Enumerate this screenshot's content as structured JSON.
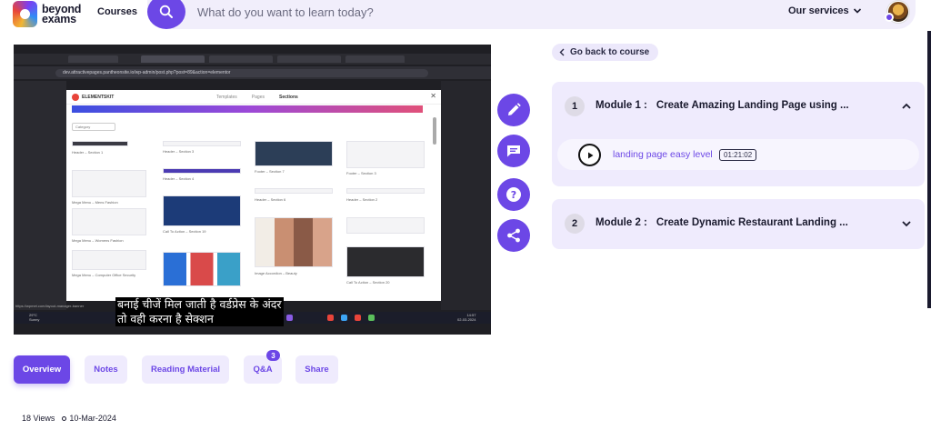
{
  "header": {
    "logo_line1": "beyond",
    "logo_line2": "exams",
    "courses_label": "Courses",
    "search_placeholder": "What do you want to learn today?",
    "services_label": "Our services"
  },
  "video": {
    "url": "dev.attractivepages.pantheonsite.io/wp-admin/post.php?post=89&action=elementor",
    "modal_brand": "ELEMENTSKIT",
    "modal_tabs": [
      "Templates",
      "Pages",
      "Sections"
    ],
    "category_select": "Category",
    "status_link": "https://wpmet.com/layout-manager-banner",
    "temperature": "29°C",
    "weather": "Sunny",
    "time": "14:57",
    "date": "02-03-2024",
    "subtitle_line1": "बनाई चीजें मिल जाती है वर्डप्रेस के अंदर",
    "subtitle_line2": "तो वही करना है सेक्शन",
    "cards": [
      "Header – Section 1",
      "Header – Section 3",
      "Footer – Section 7",
      "Footer – Section 3",
      "Mega Menu – Mens Fashion",
      "Header – Section 4",
      "Header – Section 6",
      "Header – Section 2",
      "Mega Menu – Womens Fashion",
      "Call To Action – Section 19",
      "Image Accordion – Beauty",
      "Call To Action – Section 20",
      "Mega Menu – Computer Office Security"
    ]
  },
  "actions": [
    "edit-icon",
    "chat-icon",
    "help-icon",
    "share-icon"
  ],
  "right_panel": {
    "go_back_label": "Go back to course",
    "modules": [
      {
        "number": "1",
        "label": "Module 1 :",
        "title": "Create Amazing Landing Page using ...",
        "lessons": [
          {
            "title": "landing page easy level",
            "duration": "01:21:02"
          }
        ]
      },
      {
        "number": "2",
        "label": "Module 2 :",
        "title": "Create Dynamic Restaurant Landing ..."
      }
    ]
  },
  "tabs": [
    {
      "label": "Overview",
      "active": true
    },
    {
      "label": "Notes",
      "active": false
    },
    {
      "label": "Reading Material",
      "active": false
    },
    {
      "label": "Q&A",
      "active": false,
      "badge": "3"
    },
    {
      "label": "Share",
      "active": false
    }
  ],
  "meta": {
    "views": "18 Views",
    "date": "10-Mar-2024"
  },
  "colors": {
    "accent": "#6c47e6",
    "panel": "#efebfd",
    "search_bg": "#f1eefb"
  }
}
